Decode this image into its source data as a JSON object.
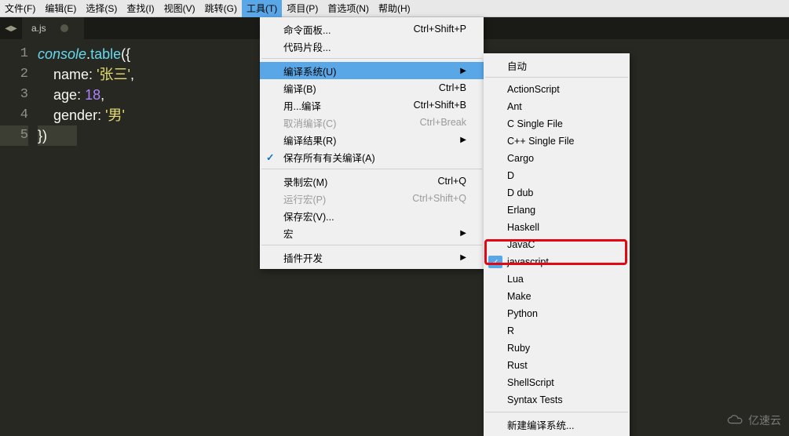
{
  "menubar": {
    "items": [
      {
        "label": "文件(F)"
      },
      {
        "label": "编辑(E)"
      },
      {
        "label": "选择(S)"
      },
      {
        "label": "查找(I)"
      },
      {
        "label": "视图(V)"
      },
      {
        "label": "跳转(G)"
      },
      {
        "label": "工具(T)",
        "active": true
      },
      {
        "label": "项目(P)"
      },
      {
        "label": "首选项(N)"
      },
      {
        "label": "帮助(H)"
      }
    ]
  },
  "tabs": {
    "active_file": "a.js"
  },
  "code": {
    "line1_console": "console",
    "line1_dot": ".",
    "line1_table": "table",
    "line1_paren": "({",
    "line2_key": "name",
    "line2_colon": ": ",
    "line2_val": "'张三'",
    "line2_comma": ",",
    "line3_key": "age",
    "line3_colon": ": ",
    "line3_val": "18",
    "line3_comma": ",",
    "line4_key": "gender",
    "line4_colon": ": ",
    "line4_val": "'男'",
    "line5": "})"
  },
  "gutter": {
    "l1": "1",
    "l2": "2",
    "l3": "3",
    "l4": "4",
    "l5": "5"
  },
  "tools_menu": {
    "i0": {
      "label": "命令面板...",
      "shortcut": "Ctrl+Shift+P"
    },
    "i1": {
      "label": "代码片段..."
    },
    "i2": {
      "label": "编译系统(U)"
    },
    "i3": {
      "label": "编译(B)",
      "shortcut": "Ctrl+B"
    },
    "i4": {
      "label": "用...编译",
      "shortcut": "Ctrl+Shift+B"
    },
    "i5": {
      "label": "取消编译(C)",
      "shortcut": "Ctrl+Break"
    },
    "i6": {
      "label": "编译结果(R)"
    },
    "i7": {
      "label": "保存所有有关编译(A)"
    },
    "i8": {
      "label": "录制宏(M)",
      "shortcut": "Ctrl+Q"
    },
    "i9": {
      "label": "运行宏(P)",
      "shortcut": "Ctrl+Shift+Q"
    },
    "i10": {
      "label": "保存宏(V)..."
    },
    "i11": {
      "label": "宏"
    },
    "i12": {
      "label": "插件开发"
    }
  },
  "build_menu": {
    "b0": "自动",
    "b1": "ActionScript",
    "b2": "Ant",
    "b3": "C Single File",
    "b4": "C++ Single File",
    "b5": "Cargo",
    "b6": "D",
    "b7": "D dub",
    "b8": "Erlang",
    "b9": "Haskell",
    "b10": "JavaC",
    "b11": "javascript",
    "b12": "Lua",
    "b13": "Make",
    "b14": "Python",
    "b15": "R",
    "b16": "Ruby",
    "b17": "Rust",
    "b18": "ShellScript",
    "b19": "Syntax Tests",
    "b20": "新建编译系统..."
  },
  "watermark": "亿速云"
}
